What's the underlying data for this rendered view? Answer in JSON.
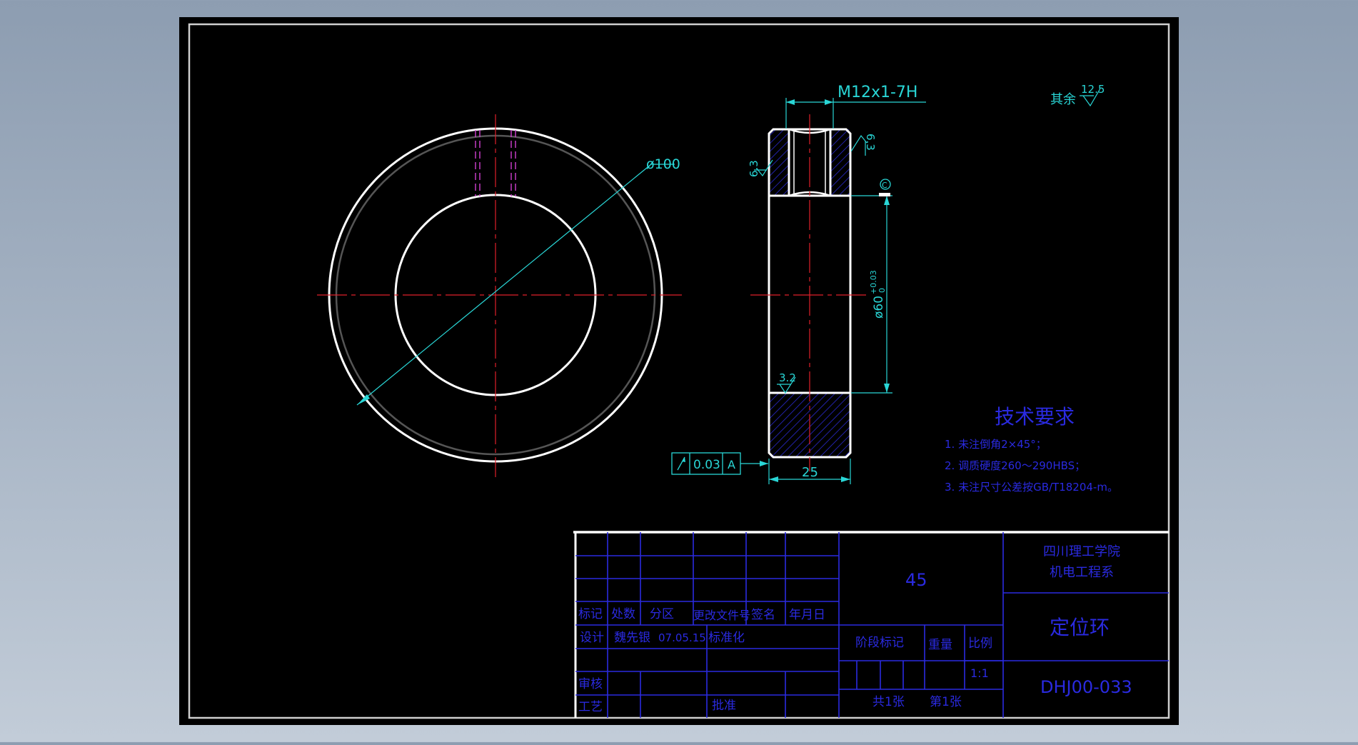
{
  "drawing": {
    "thread_callout": "M12x1-7H",
    "outer_diameter_label": "ø100",
    "bore_diameter_label": "ø60",
    "bore_tol_upper": "+0.03",
    "bore_tol_lower": "0",
    "width_label": "25",
    "rough_top_left": "6.3",
    "rough_top_right": "6.3",
    "rough_bore": "3.2",
    "rough_general_prefix": "其余",
    "rough_general_value": "12.5",
    "datum_circle": "C",
    "gdt": {
      "tolerance": "0.03",
      "datum": "A"
    }
  },
  "tech_requirements": {
    "title": "技术要求",
    "items": [
      "1. 未注倒角2×45°；",
      "2. 调质硬度260～290HBS；",
      "3. 未注尺寸公差按GB/T18204-m。"
    ]
  },
  "title_block": {
    "material": "45",
    "school_line1": "四川理工学院",
    "school_line2": "机电工程系",
    "part_name": "定位环",
    "drawing_number": "DHJ00-033",
    "headers": {
      "mark": "标记",
      "count": "处数",
      "zone": "分区",
      "change_doc": "更改文件号",
      "signature": "签名",
      "date": "年月日"
    },
    "design_label": "设计",
    "designer": "魏先银",
    "design_date": "07.05.15",
    "standardize": "标准化",
    "review": "审核",
    "process": "工艺",
    "approve": "批准",
    "stage_mark": "阶段标记",
    "weight": "重量",
    "scale_label": "比例",
    "scale_value": "1:1",
    "sheets_total": "共1张",
    "sheet_no": "第1张"
  },
  "colors": {
    "background": "#000000",
    "outline": "#ffffff",
    "centerline": "#e0202a",
    "dimension": "#29d6d6",
    "table": "#2a2ae0",
    "hidden": "#d040d0",
    "hatch": "#2a2ad0"
  }
}
